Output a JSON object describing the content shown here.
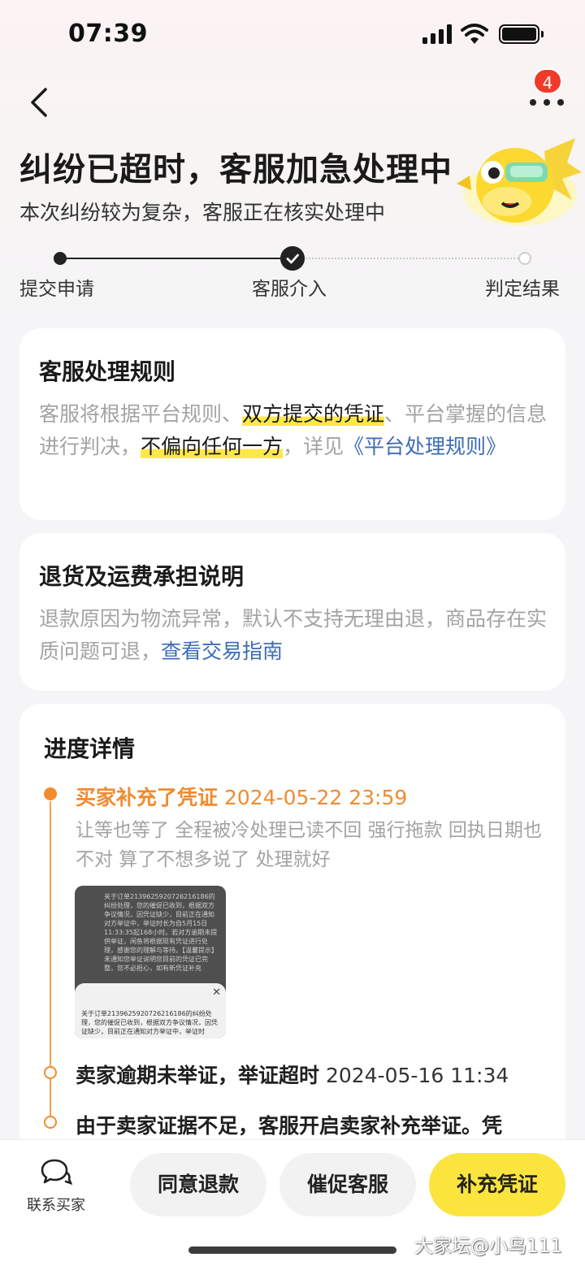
{
  "status_bar": {
    "time": "07:39"
  },
  "header": {
    "badge_count": "4"
  },
  "hero": {
    "title": "纠纷已超时，客服加急处理中",
    "subtitle": "本次纠纷较为复杂，客服正在核实处理中"
  },
  "steps": [
    "提交申请",
    "客服介入",
    "判定结果"
  ],
  "rules_card": {
    "title": "客服处理规则",
    "t1": "客服将根据平台规则、",
    "h1": "双方提交的凭证",
    "t2": "、平台掌握的信息进行判决，",
    "h2": "不偏向任何一方",
    "t3": "，详见",
    "link": "《平台处理规则》"
  },
  "return_card": {
    "title": "退货及运费承担说明",
    "text": "退款原因为物流异常，默认不支持无理由退，商品存在实质问题可退，",
    "link": "查看交易指南"
  },
  "progress": {
    "title": "进度详情",
    "events": [
      {
        "title": "买家补充了凭证",
        "time": "2024-05-22 23:59",
        "desc": "让等也等了 全程被冷处理已读不回 强行拖款 回执日期也不对 算了不想多说了 处理就好",
        "image_text": "关于订单2139625920726216186的纠纷处理，您的催促已收到，根据双方争议情况，因凭证缺少，目前正在通知对方举证中，举证时长为自5月15日 11:33:35起168小时。若对方逾期未提供举证，闲鱼将根据现有凭证进行处理，感谢您的理解与等待。【温馨提示】未通知您举证说明您目前的凭证已完整，您不必担心，如有新凭证补充",
        "image_popup": "关于订单2139625920726216186的纠纷处理，您的催促已收到，根据双方争议情况，因凭证缺少，目前正在通知对方举证中，举证时"
      },
      {
        "title": "卖家逾期未举证，举证超时",
        "time": "2024-05-16 11:34"
      },
      {
        "title": "由于卖家证据不足，客服开启卖家补充举证。凭"
      }
    ]
  },
  "bottom_bar": {
    "contact_label": "联系买家",
    "btn_agree": "同意退款",
    "btn_urge": "催促客服",
    "btn_supplement": "补充凭证"
  },
  "watermark": "大家坛@小鸟111"
}
